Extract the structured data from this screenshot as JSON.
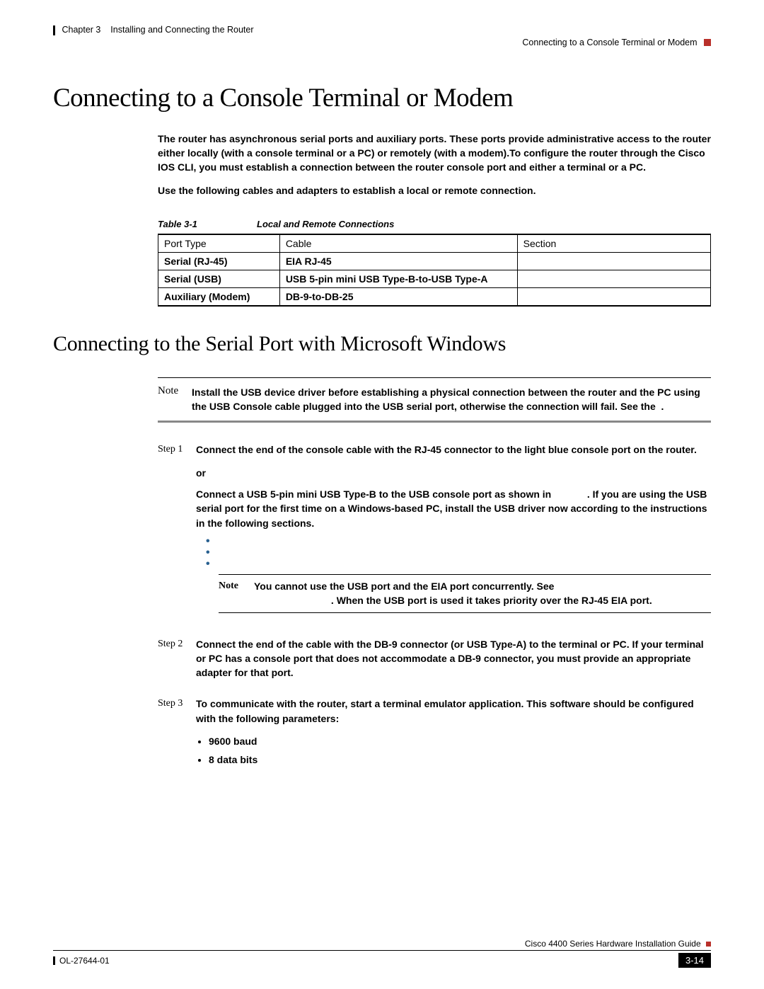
{
  "header": {
    "chapter": "Chapter 3",
    "chapter_title": "Installing and Connecting the Router",
    "section": "Connecting to a Console Terminal or Modem"
  },
  "title": "Connecting to a Console Terminal or Modem",
  "intro_p1": "The router has asynchronous serial ports and auxiliary ports. These ports provide administrative access to the router either locally (with a console terminal or a PC) or remotely (with a modem).To configure the router through the Cisco IOS CLI, you must establish a connection between the router console port and either a terminal or a PC.",
  "intro_p2": "Use the following cables and adapters to establish a local or remote connection.",
  "table": {
    "caption_label": "Table 3-1",
    "caption_title": "Local and Remote Connections",
    "headers": {
      "c1": "Port Type",
      "c2": "Cable",
      "c3": "Section"
    },
    "rows": [
      {
        "c1": "Serial (RJ-45)",
        "c2": "EIA RJ-45",
        "c3": ""
      },
      {
        "c1": "Serial (USB)",
        "c2": "USB 5-pin mini USB Type-B-to-USB Type-A",
        "c3": ""
      },
      {
        "c1": "Auxiliary (Modem)",
        "c2": "DB-9-to-DB-25",
        "c3": ""
      }
    ]
  },
  "subtitle": "Connecting to the Serial Port with Microsoft Windows",
  "note1": {
    "label": "Note",
    "text_a": "Install the USB device driver before establishing a physical connection between the router and the PC using the USB Console cable plugged into the USB serial port, otherwise the connection will fail. See the ",
    "text_b": "."
  },
  "step1": {
    "label": "Step 1",
    "p1": "Connect the end of the console cable with the RJ-45 connector to the light blue console port on the router.",
    "or": "or",
    "p2a": "Connect a USB 5-pin mini USB Type-B to the USB console port as shown in ",
    "p2b": ". If you are using the USB serial port for the first time on a Windows-based PC, install the USB driver now according to the instructions in the following sections."
  },
  "note2": {
    "label": "Note",
    "line1": "You cannot use the USB port and the EIA port concurrently. See ",
    "line2": ". When the USB port is used it takes priority over the RJ-45 EIA port."
  },
  "step2": {
    "label": "Step 2",
    "text": "Connect the end of the cable with the DB-9 connector (or USB Type-A) to the terminal or PC. If your terminal or PC has a console port that does not accommodate a DB-9 connector, you must provide an appropriate adapter for that port."
  },
  "step3": {
    "label": "Step 3",
    "text": "To communicate with the router, start a terminal emulator application. This software should be configured with the following parameters:",
    "bullets": [
      "9600 baud",
      "8 data bits"
    ]
  },
  "footer": {
    "guide": "Cisco 4400 Series Hardware Installation Guide",
    "doc_id": "OL-27644-01",
    "page": "3-14"
  }
}
